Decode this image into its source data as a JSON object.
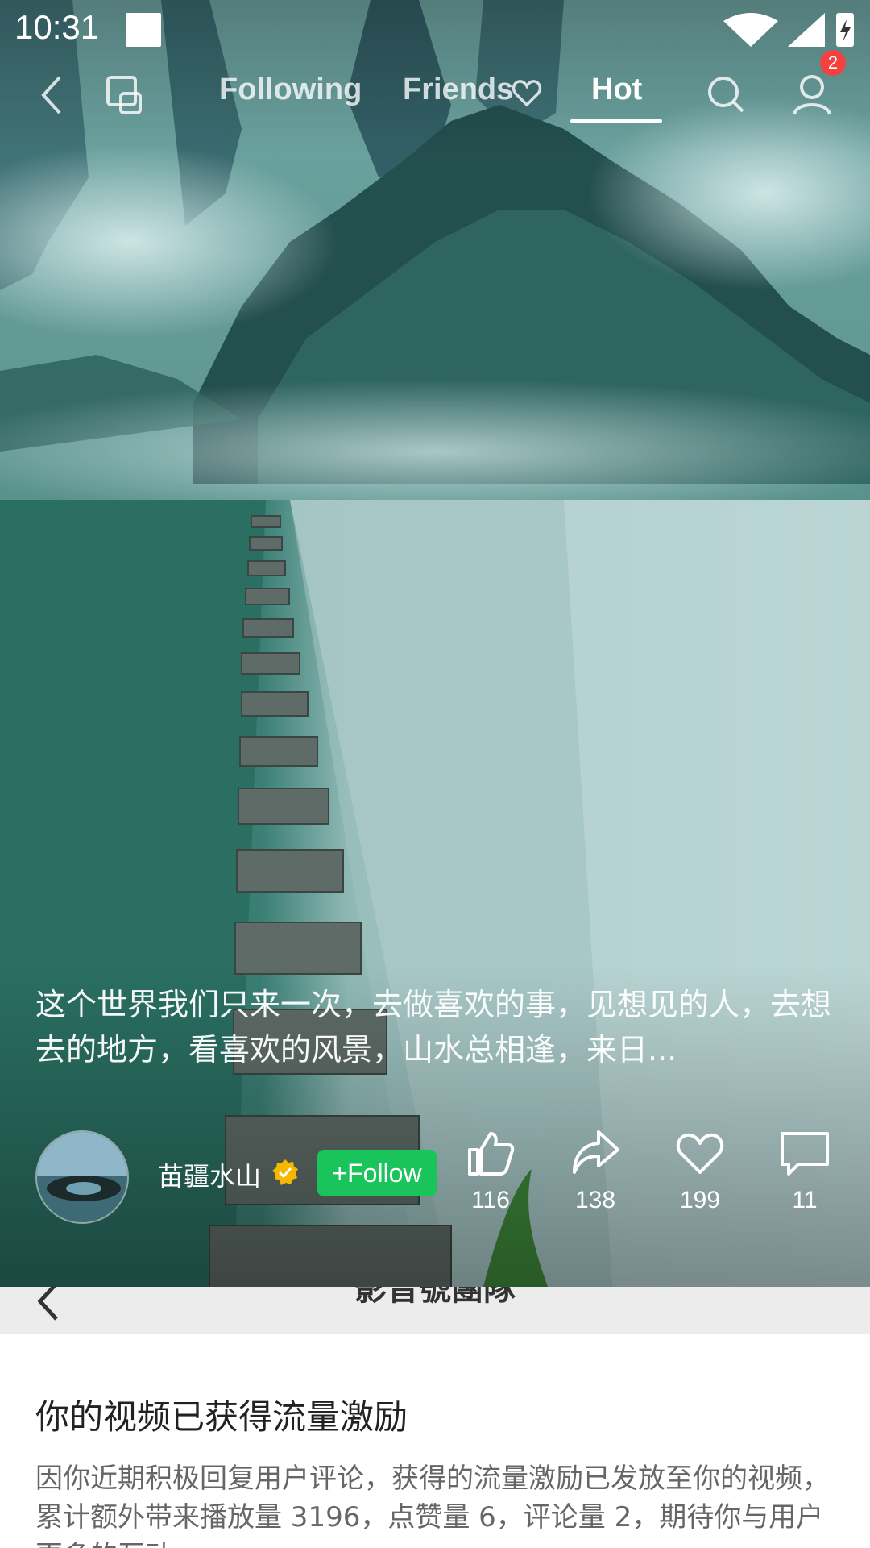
{
  "status_bar": {
    "time": "10:31"
  },
  "top_nav": {
    "tabs": [
      {
        "label": "Following"
      },
      {
        "label": "Friends"
      },
      {
        "label": "Hot"
      }
    ],
    "active_tab": "Hot",
    "profile_badge": "2"
  },
  "post": {
    "caption": "这个世界我们只来一次，去做喜欢的事，见想见的人，去想去的地方，看喜欢的风景，山水总相逢，来日...",
    "author": {
      "name": "苗疆水山",
      "verified": true
    },
    "follow_label": "+Follow",
    "actions": {
      "likes": "116",
      "shares": "138",
      "favorites": "199",
      "comments": "11"
    }
  },
  "panel": {
    "title": "影音號團隊",
    "notice_title": "你的视频已获得流量激励",
    "notice_text": "因你近期积极回复用户评论，获得的流量激励已发放至你的视频，累计额外带来播放量 3196，点赞量 6，评论量 2，期待你与用户更多的互动。"
  },
  "colors": {
    "follow_button": "#19c55a",
    "badge": "#f2413f",
    "verified": "#f5b800"
  }
}
